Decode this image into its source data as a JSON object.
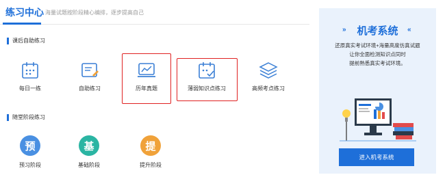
{
  "header": {
    "title": "练习中心",
    "subtitle": "海量试题按阶段精心编排，逐步提高自己"
  },
  "sections": {
    "self_practice": "课后自助练习",
    "stage_practice": "随堂阶段练习"
  },
  "practice_items": [
    {
      "label": "每日一练",
      "icon": "calendar-icon"
    },
    {
      "label": "自助练习",
      "icon": "writing-board-icon"
    },
    {
      "label": "历年真题",
      "icon": "monitor-chart-icon"
    },
    {
      "label": "薄弱知识点练习",
      "icon": "calendar-check-icon"
    },
    {
      "label": "高频考点练习",
      "icon": "stack-layers-icon"
    }
  ],
  "stages": [
    {
      "char": "预",
      "label": "预习阶段",
      "color": "#4a90e2"
    },
    {
      "char": "基",
      "label": "基础阶段",
      "color": "#2bb5a3"
    },
    {
      "char": "提",
      "label": "提升阶段",
      "color": "#f0a23a"
    }
  ],
  "panel": {
    "chevrons_left": "»",
    "title": "机考系统",
    "chevrons_right": "«",
    "desc_line1": "还原真实考试环境+海量高度仿真试题",
    "desc_line2": "让你全面检测知识点同时",
    "desc_line3": "提前熟悉真实考试环境。",
    "button": "进入机考系统"
  },
  "colors": {
    "accent": "#1e6fd9",
    "highlight": "#e02020",
    "panel_bg": "#eaf2fc"
  }
}
